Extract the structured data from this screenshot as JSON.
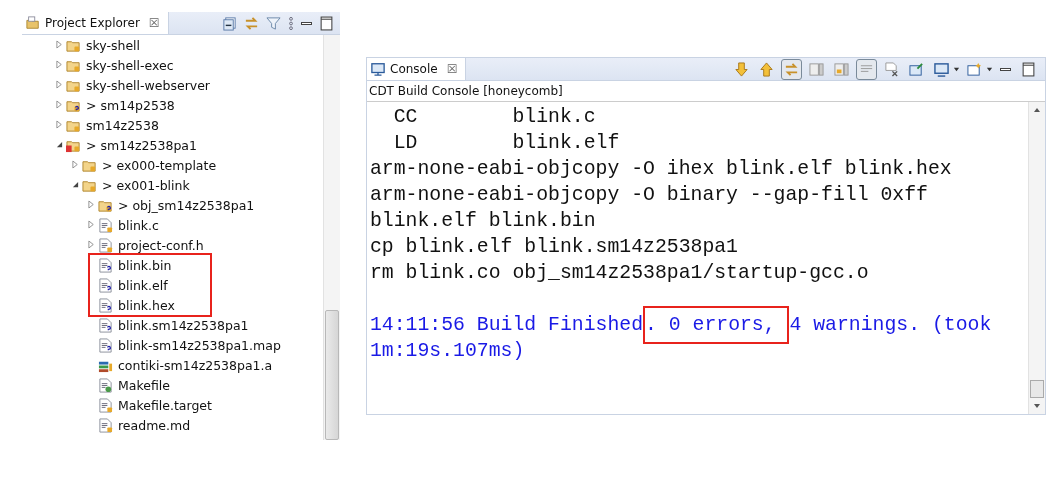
{
  "explorer": {
    "title": "Project Explorer",
    "close": "☒",
    "toolbar": [
      {
        "kind": "collapse"
      },
      {
        "kind": "link"
      },
      {
        "kind": "filter"
      },
      {
        "kind": "menu"
      },
      {
        "kind": "minimize"
      },
      {
        "kind": "maximize"
      }
    ],
    "tree": [
      {
        "label": "sky-shell",
        "kind": "project",
        "expanded": false,
        "highlighted": false
      },
      {
        "label": "sky-shell-exec",
        "kind": "project",
        "expanded": false,
        "highlighted": false
      },
      {
        "label": "sky-shell-webserver",
        "kind": "project",
        "expanded": false,
        "highlighted": false
      },
      {
        "label": "> sm14p2538",
        "kind": "project-unknown",
        "expanded": false,
        "highlighted": false
      },
      {
        "label": "sm14z2538",
        "kind": "project",
        "expanded": false,
        "highlighted": false
      },
      {
        "label": "> sm14z2538pa1",
        "kind": "project-error",
        "expanded": true,
        "highlighted": false,
        "children": [
          {
            "label": "> ex000-template",
            "kind": "folder",
            "expanded": false,
            "highlighted": false
          },
          {
            "label": "> ex001-blink",
            "kind": "folder",
            "expanded": true,
            "highlighted": false,
            "children": [
              {
                "label": "> obj_sm14z2538pa1",
                "kind": "folder-unknown",
                "expanded": false,
                "highlighted": false
              },
              {
                "label": "blink.c",
                "kind": "c-file",
                "expanded": false,
                "highlighted": false
              },
              {
                "label": "project-conf.h",
                "kind": "h-file",
                "expanded": false,
                "highlighted": false
              },
              {
                "label": "blink.bin",
                "kind": "file-unknown",
                "highlighted": true
              },
              {
                "label": "blink.elf",
                "kind": "binary-unknown",
                "highlighted": true
              },
              {
                "label": "blink.hex",
                "kind": "file-unknown",
                "highlighted": true
              },
              {
                "label": "blink.sm14z2538pa1",
                "kind": "file-unknown",
                "highlighted": false
              },
              {
                "label": "blink-sm14z2538pa1.map",
                "kind": "file-unknown",
                "highlighted": false
              },
              {
                "label": "contiki-sm14z2538pa1.a",
                "kind": "library",
                "highlighted": false
              },
              {
                "label": "Makefile",
                "kind": "makefile",
                "highlighted": false
              },
              {
                "label": "Makefile.target",
                "kind": "text-file",
                "highlighted": false
              },
              {
                "label": "readme.md",
                "kind": "text-file",
                "highlighted": false
              }
            ]
          }
        ]
      }
    ]
  },
  "console": {
    "title": "Console",
    "close": "☒",
    "subtitle": "CDT Build Console [honeycomb]",
    "toolbar": [
      {
        "kind": "scroll-down",
        "pressed": false
      },
      {
        "kind": "scroll-up",
        "pressed": false
      },
      {
        "kind": "scroll-lock",
        "pressed": true
      },
      {
        "kind": "pin-page",
        "pressed": false
      },
      {
        "kind": "lock-page",
        "pressed": false
      },
      {
        "kind": "word-wrap",
        "pressed": true
      },
      {
        "kind": "clear",
        "pressed": false
      },
      {
        "kind": "pin",
        "pressed": false
      },
      {
        "kind": "display",
        "pressed": false
      },
      {
        "kind": "new",
        "pressed": false
      },
      {
        "kind": "minimize",
        "pressed": false
      },
      {
        "kind": "maximize",
        "pressed": false
      }
    ],
    "lines": [
      {
        "kind": "output",
        "parts": [
          {
            "text": "  CC        blink.c",
            "boxed": false
          }
        ]
      },
      {
        "kind": "output",
        "parts": [
          {
            "text": "  LD        blink.elf",
            "boxed": false
          }
        ]
      },
      {
        "kind": "output",
        "parts": [
          {
            "text": "arm-none-eabi-objcopy -O ihex blink.elf blink.hex",
            "boxed": false
          }
        ]
      },
      {
        "kind": "output",
        "parts": [
          {
            "text": "arm-none-eabi-objcopy -O binary --gap-fill 0xff",
            "boxed": false
          }
        ]
      },
      {
        "kind": "output",
        "parts": [
          {
            "text": "blink.elf blink.bin",
            "boxed": false
          }
        ]
      },
      {
        "kind": "output",
        "parts": [
          {
            "text": "cp blink.elf blink.sm14z2538pa1",
            "boxed": false
          }
        ]
      },
      {
        "kind": "output",
        "parts": [
          {
            "text": "rm blink.co obj_sm14z2538pa1/startup-gcc.o",
            "boxed": false
          }
        ]
      },
      {
        "kind": "blank"
      },
      {
        "kind": "status",
        "parts": [
          {
            "text": "14:11:56 Build Finished",
            "boxed": false
          },
          {
            "text": ". 0 errors, ",
            "boxed": true
          },
          {
            "text": "4 warnings. (took",
            "boxed": false
          }
        ]
      },
      {
        "kind": "status",
        "parts": [
          {
            "text": "1m:19s.107ms)",
            "boxed": false
          }
        ]
      }
    ]
  }
}
